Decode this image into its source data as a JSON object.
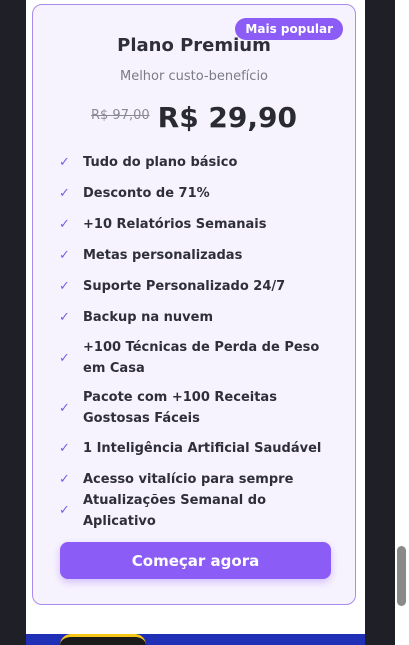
{
  "plan": {
    "badge": "Mais popular",
    "title": "Plano Premium",
    "subtitle": "Melhor custo-benefício",
    "old_price": "R$ 97,00",
    "price": "R$ 29,90",
    "features": [
      "Tudo do plano básico",
      "Desconto de 71%",
      "+10 Relatórios Semanais",
      "Metas personalizadas",
      "Suporte Personalizado 24/7",
      "Backup na nuvem",
      "+100 Técnicas de Perda de Peso em Casa",
      "Pacote com +100 Receitas Gostosas Fáceis",
      "1 Inteligência Artificial Saudável",
      "Acesso vitalício para sempre",
      "Atualizações Semanal do Aplicativo"
    ],
    "cta_label": "Começar agora"
  },
  "colors": {
    "accent": "#8b5cf6",
    "card_border": "#a98bf0",
    "card_bg": "#f7f3fe",
    "check": "#7c5ce6"
  },
  "icons": {
    "feature": "check-icon"
  }
}
